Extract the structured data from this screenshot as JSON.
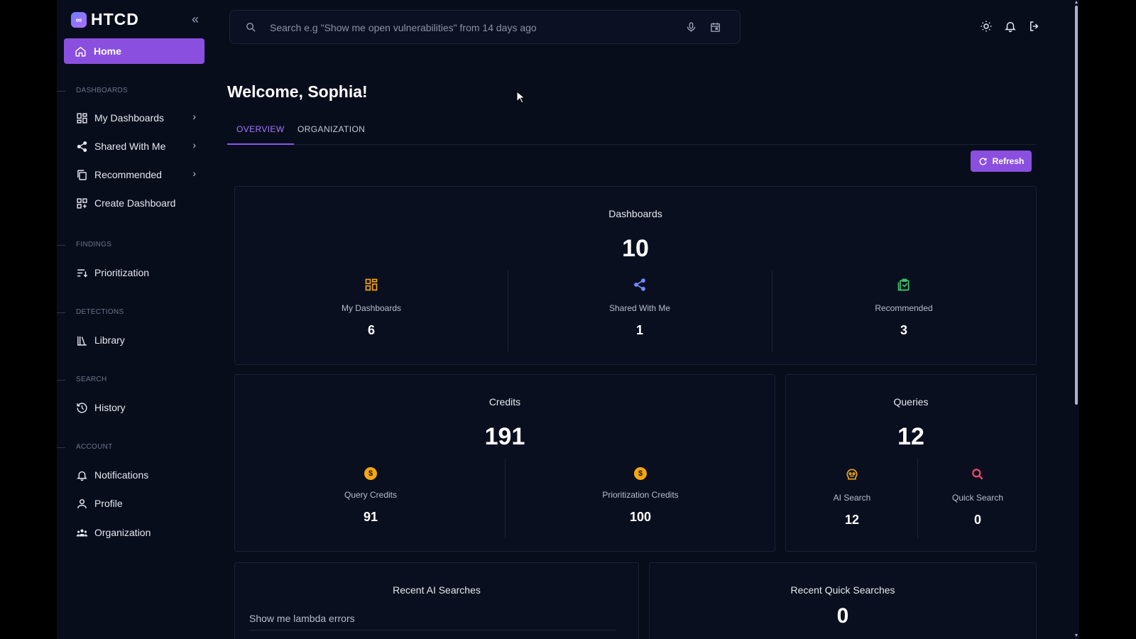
{
  "brand": {
    "name": "HTCD"
  },
  "sidebar": {
    "home_label": "Home",
    "sections": {
      "dashboards": "DASHBOARDS",
      "findings": "FINDINGS",
      "detections": "DETECTIONS",
      "search": "SEARCH",
      "account": "ACCOUNT"
    },
    "items": {
      "my_dashboards": "My Dashboards",
      "shared_with_me": "Shared With Me",
      "recommended": "Recommended",
      "create_dashboard": "Create Dashboard",
      "prioritization": "Prioritization",
      "library": "Library",
      "history": "History",
      "notifications": "Notifications",
      "profile": "Profile",
      "organization": "Organization"
    }
  },
  "search": {
    "placeholder": "Search e.g \"Show me open vulnerabilities\" from 14 days ago"
  },
  "welcome": "Welcome, Sophia!",
  "tabs": {
    "overview": "OVERVIEW",
    "organization": "ORGANIZATION"
  },
  "refresh_label": "Refresh",
  "dashboards_card": {
    "title": "Dashboards",
    "total": "10",
    "my_dashboards": {
      "label": "My Dashboards",
      "value": "6"
    },
    "shared_with_me": {
      "label": "Shared With Me",
      "value": "1"
    },
    "recommended": {
      "label": "Recommended",
      "value": "3"
    }
  },
  "credits_card": {
    "title": "Credits",
    "total": "191",
    "query_credits": {
      "label": "Query Credits",
      "value": "91"
    },
    "prioritization_credits": {
      "label": "Prioritization Credits",
      "value": "100"
    },
    "coin_symbol": "$"
  },
  "queries_card": {
    "title": "Queries",
    "total": "12",
    "ai_search": {
      "label": "AI Search",
      "value": "12"
    },
    "quick_search": {
      "label": "Quick Search",
      "value": "0"
    }
  },
  "recent_ai": {
    "title": "Recent AI Searches",
    "items": [
      "Show me lambda errors"
    ]
  },
  "recent_quick": {
    "title": "Recent Quick Searches",
    "count": "0"
  },
  "colors": {
    "accent": "#8b4fe0",
    "background": "#080d1c",
    "card": "#0a0f1f",
    "coin": "#f3a712",
    "green_icon": "#38c96a",
    "orange_icon": "#f3a712",
    "blue_icon": "#6f8bff",
    "red_icon": "#ff4d6d"
  }
}
